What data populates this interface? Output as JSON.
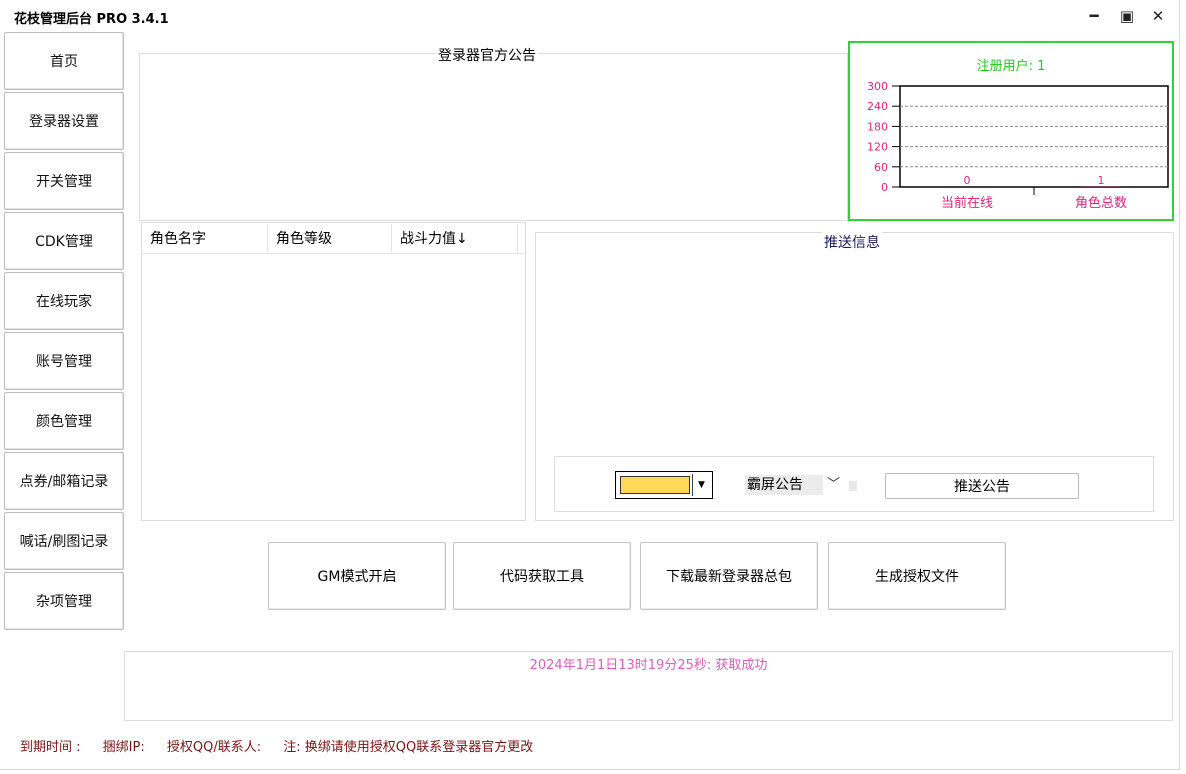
{
  "window": {
    "title": "花枝管理后台 PRO 3.4.1",
    "minimize_glyph": "━",
    "maximize_glyph": "▣",
    "close_glyph": "✕"
  },
  "sidebar": {
    "items": [
      {
        "label": "首页"
      },
      {
        "label": "登录器设置"
      },
      {
        "label": "开关管理"
      },
      {
        "label": "CDK管理"
      },
      {
        "label": "在线玩家"
      },
      {
        "label": "账号管理"
      },
      {
        "label": "颜色管理"
      },
      {
        "label": "点券/邮箱记录"
      },
      {
        "label": "喊话/刷图记录"
      },
      {
        "label": "杂项管理"
      }
    ]
  },
  "announcement": {
    "title": "登录器官方公告"
  },
  "stats": {
    "title": "注册用户: 1"
  },
  "chart_data": {
    "type": "bar",
    "categories": [
      "当前在线",
      "角色总数"
    ],
    "values": [
      0,
      1
    ],
    "ylim": [
      0,
      300
    ],
    "yticks": [
      0,
      60,
      120,
      180,
      240,
      300
    ],
    "grid": true,
    "colors": {
      "axis_text": "#e0247a",
      "grid": "#888888",
      "frame": "#000000"
    }
  },
  "players_table": {
    "columns": [
      "角色名字",
      "角色等级",
      "战斗力值↓"
    ],
    "rows": []
  },
  "push": {
    "title": "推送信息",
    "color_value": "#ffd85a",
    "mode_selected": "霸屏公告",
    "button_label": "推送公告"
  },
  "actions": [
    {
      "label": "GM模式开启"
    },
    {
      "label": "代码获取工具"
    },
    {
      "label": "下载最新登录器总包"
    },
    {
      "label": "生成授权文件"
    }
  ],
  "log": {
    "line": "2024年1月1日13时19分25秒: 获取成功"
  },
  "status": {
    "expiry": "到期时间 :",
    "bind_ip": "捆绑IP:",
    "auth_qq": "授权QQ/联系人:",
    "note": "注: 换绑请使用授权QQ联系登录器官方更改"
  },
  "accent": "#33d233"
}
